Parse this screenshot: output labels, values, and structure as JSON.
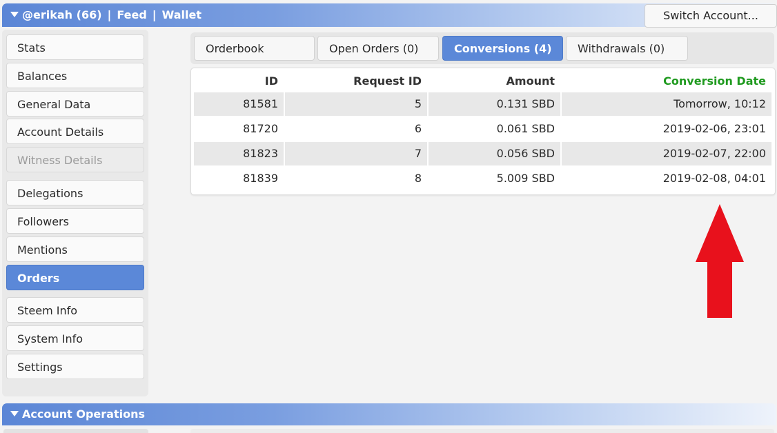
{
  "header": {
    "account": "@erikah (66)",
    "separator": "|",
    "feed": "Feed",
    "wallet": "Wallet",
    "switch_account": "Switch Account..."
  },
  "sidebar": {
    "items": [
      {
        "label": "Stats"
      },
      {
        "label": "Balances"
      },
      {
        "label": "General Data"
      },
      {
        "label": "Account Details"
      },
      {
        "label": "Witness Details"
      },
      {
        "label": "Delegations"
      },
      {
        "label": "Followers"
      },
      {
        "label": "Mentions"
      },
      {
        "label": "Orders"
      },
      {
        "label": "Steem Info"
      },
      {
        "label": "System Info"
      },
      {
        "label": "Settings"
      }
    ],
    "active": "Orders",
    "disabled": "Witness Details"
  },
  "tabs": [
    {
      "label": "Orderbook"
    },
    {
      "label": "Open Orders (0)"
    },
    {
      "label": "Conversions (4)"
    },
    {
      "label": "Withdrawals (0)"
    }
  ],
  "active_tab": "Conversions (4)",
  "table": {
    "headers": [
      "ID",
      "Request ID",
      "Amount",
      "Conversion Date"
    ],
    "rows": [
      [
        "81581",
        "5",
        "0.131 SBD",
        "Tomorrow, 10:12"
      ],
      [
        "81720",
        "6",
        "0.061 SBD",
        "2019-02-06, 23:01"
      ],
      [
        "81823",
        "7",
        "0.056 SBD",
        "2019-02-07, 22:00"
      ],
      [
        "81839",
        "8",
        "5.009 SBD",
        "2019-02-08, 04:01"
      ]
    ]
  },
  "footer": {
    "title": "Account Operations"
  },
  "colors": {
    "accent": "#5b88d8",
    "sorted_header": "#1f9a1f",
    "arrow": "#e8111c"
  }
}
